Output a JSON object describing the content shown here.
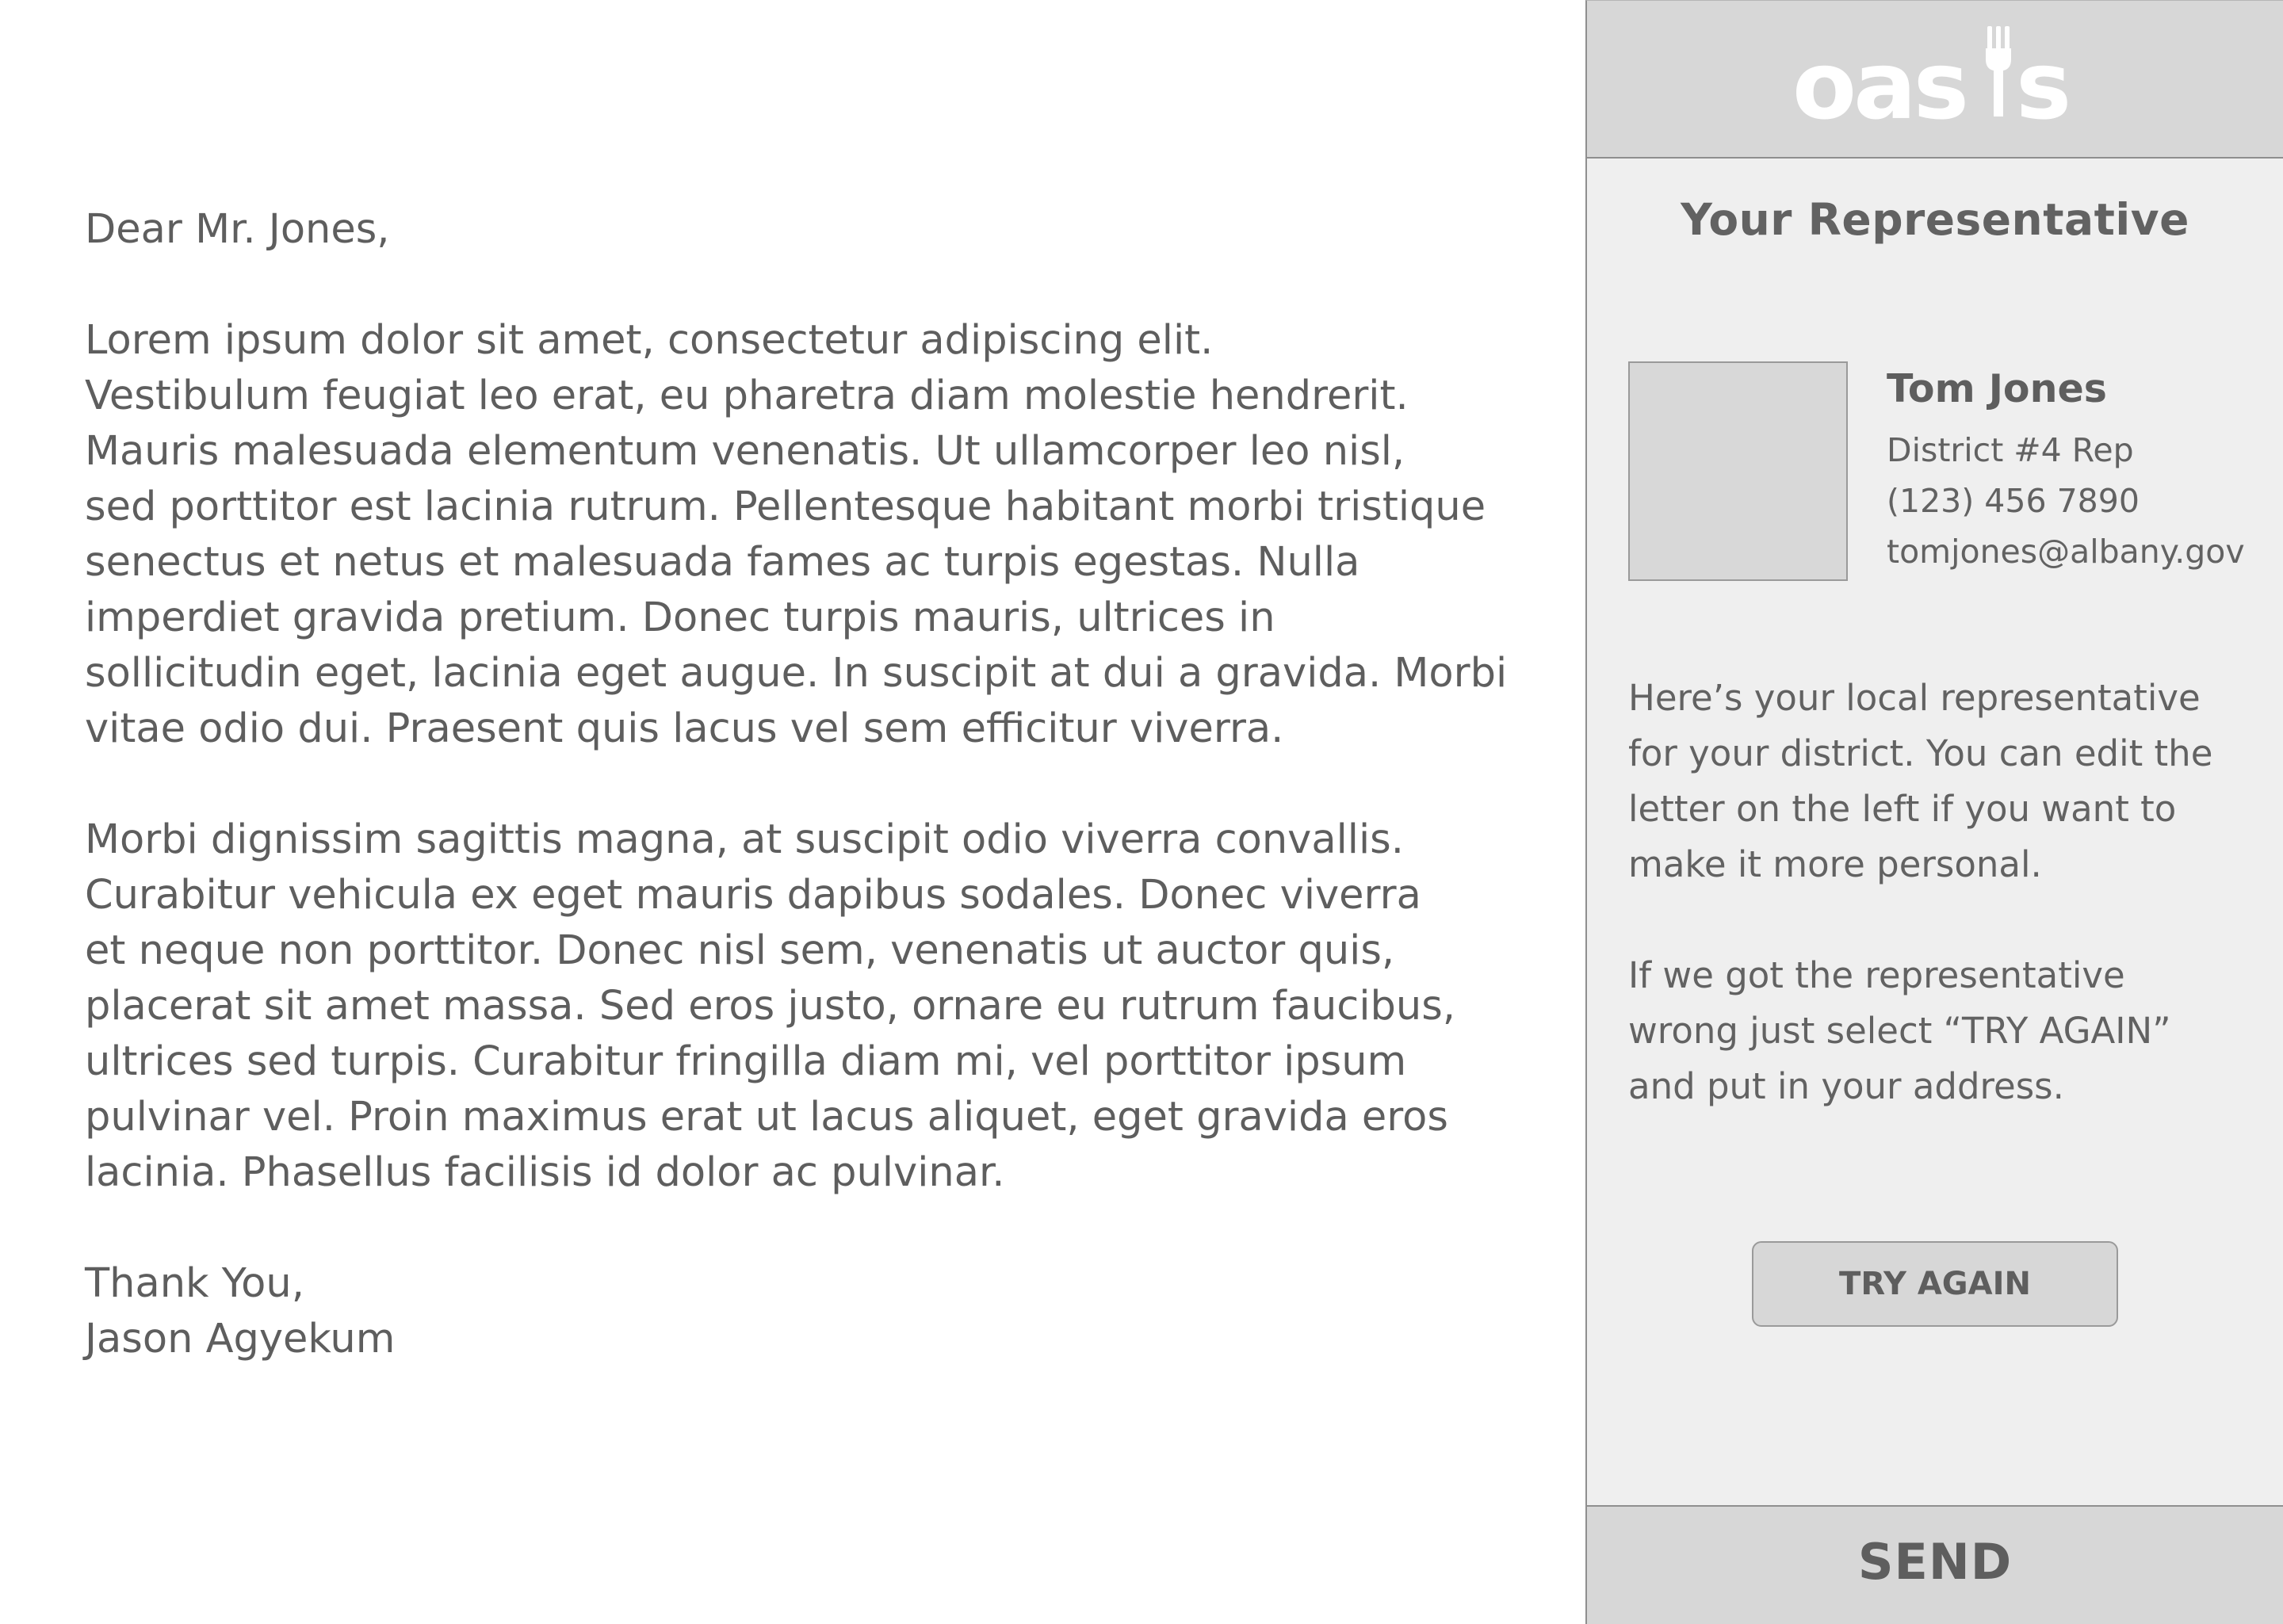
{
  "letter": {
    "greeting": "Dear Mr. Jones,",
    "paragraph1": [
      "Lorem ipsum dolor sit amet, consectetur adipiscing elit.",
      "Vestibulum feugiat leo erat, eu pharetra diam molestie hendrerit.",
      "Mauris malesuada elementum venenatis. Ut ullamcorper leo nisl,",
      "sed porttitor est lacinia rutrum. Pellentesque habitant morbi tristique",
      "senectus et netus et malesuada fames ac turpis egestas. Nulla",
      "imperdiet gravida pretium. Donec turpis mauris, ultrices in",
      "sollicitudin eget, lacinia eget augue. In suscipit at dui a gravida. Morbi",
      "vitae odio dui. Praesent quis lacus vel sem efficitur viverra."
    ],
    "paragraph2": [
      "Morbi dignissim sagittis magna, at suscipit odio viverra convallis.",
      "Curabitur vehicula ex eget mauris dapibus sodales. Donec viverra",
      "et neque non porttitor. Donec nisl sem, venenatis ut auctor quis,",
      "placerat sit amet massa. Sed eros justo, ornare eu rutrum faucibus,",
      "ultrices sed turpis. Curabitur fringilla diam mi, vel porttitor ipsum",
      "pulvinar vel. Proin maximus erat ut lacus aliquet, eget gravida eros",
      "lacinia. Phasellus facilisis id dolor ac pulvinar."
    ],
    "closing": "Thank You,",
    "signature": "Jason Agyekum"
  },
  "panel": {
    "logo_text": "oasis",
    "title": "Your Representative",
    "rep": {
      "name": "Tom Jones",
      "role": "District #4 Rep",
      "phone": "(123) 456 7890",
      "email": "tomjones@albany.gov"
    },
    "info_paragraph1": [
      "Here’s your local representative",
      "for your district. You can edit the",
      "letter on the left if you want to",
      "make it more personal."
    ],
    "info_paragraph2": [
      "If we got the representative",
      "wrong just select “TRY AGAIN”",
      "and put in your address."
    ],
    "try_again_label": "TRY AGAIN",
    "send_label": "SEND"
  },
  "colors": {
    "panel_bg": "#efefef",
    "header_bg": "#d7d7d7",
    "text": "#5e5e5e",
    "border": "#8f8f8f",
    "logo": "#ffffff"
  }
}
